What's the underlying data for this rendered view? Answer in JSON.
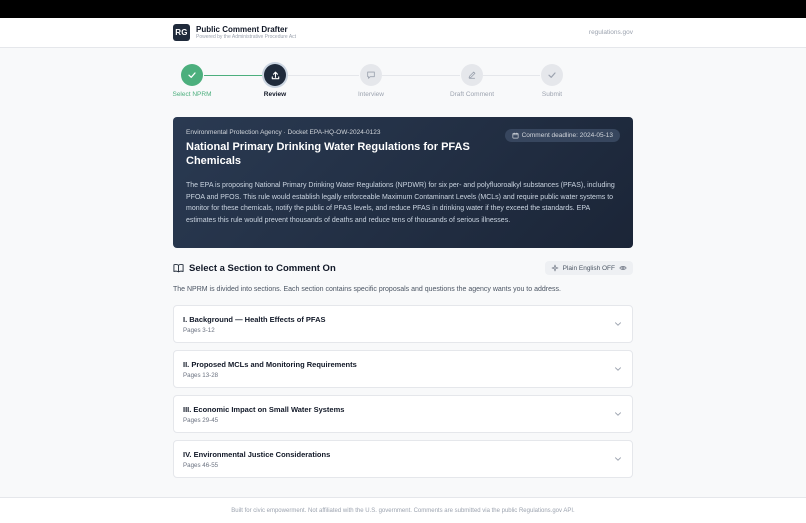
{
  "header": {
    "logo_text": "RG",
    "title": "Public Comment Drafter",
    "subtitle": "Powered by the Administrative Procedure Act",
    "external_link": "regulations.gov"
  },
  "stepper": {
    "steps": [
      {
        "label": "Select NPRM",
        "state": "done",
        "icon": "check-icon"
      },
      {
        "label": "Review",
        "state": "active",
        "icon": "upload-icon"
      },
      {
        "label": "Interview",
        "state": "todo",
        "icon": "chat-icon"
      },
      {
        "label": "Draft Comment",
        "state": "todo",
        "icon": "pencil-icon"
      },
      {
        "label": "Submit",
        "state": "todo",
        "icon": "check-icon"
      }
    ]
  },
  "hero": {
    "meta": "Environmental Protection Agency · Docket EPA-HQ-OW-2024-0123",
    "title": "National Primary Drinking Water Regulations for PFAS Chemicals",
    "deadline": "Comment deadline: 2024-05-13",
    "description": "The EPA is proposing National Primary Drinking Water Regulations (NPDWR) for six per- and polyfluoroalkyl substances (PFAS), including PFOA and PFOS. This rule would establish legally enforceable Maximum Contaminant Levels (MCLs) and require public water systems to monitor for these chemicals, notify the public of PFAS levels, and reduce PFAS in drinking water if they exceed the standards. EPA estimates this rule would prevent thousands of deaths and reduce tens of thousands of serious illnesses."
  },
  "section_picker": {
    "title": "Select a Section to Comment On",
    "plain_english_label": "Plain English OFF",
    "intro": "The NPRM is divided into sections. Each section contains specific proposals and questions the agency wants you to address.",
    "sections": [
      {
        "name": "I. Background — Health Effects of PFAS",
        "pages": "Pages 3-12"
      },
      {
        "name": "II. Proposed MCLs and Monitoring Requirements",
        "pages": "Pages 13-28"
      },
      {
        "name": "III. Economic Impact on Small Water Systems",
        "pages": "Pages 29-45"
      },
      {
        "name": "IV. Environmental Justice Considerations",
        "pages": "Pages 46-55"
      }
    ]
  },
  "footer": {
    "text": "Built for civic empowerment. Not affiliated with the U.S. government. Comments are submitted via the public Regulations.gov API."
  },
  "colors": {
    "accent_done": "#4caf7d",
    "hero_bg": "#1f2a3b"
  }
}
